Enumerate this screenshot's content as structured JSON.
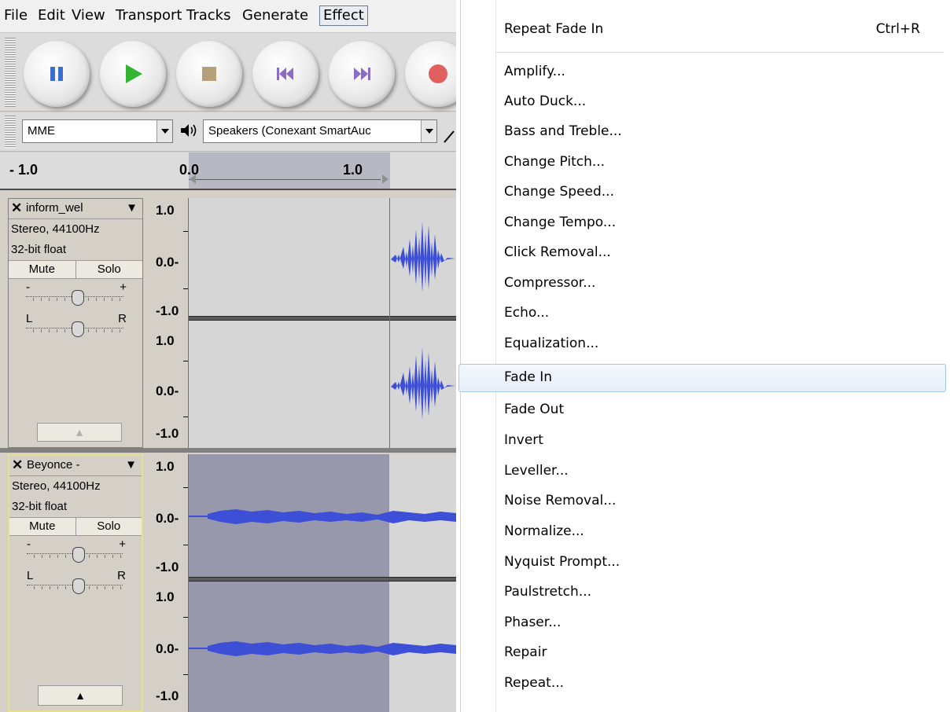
{
  "menubar": {
    "items": [
      "File",
      "Edit",
      "View",
      "Transport",
      "Tracks",
      "Generate",
      "Effect"
    ]
  },
  "devices": {
    "host": "MME",
    "output": "Speakers (Conexant SmartAuc"
  },
  "ruler": {
    "labels": [
      "- 1.0",
      "0.0",
      "1.0"
    ]
  },
  "tracks": [
    {
      "name": "inform_wel",
      "format": "Stereo, 44100Hz",
      "bits": "32-bit float",
      "mute": "Mute",
      "solo": "Solo",
      "gain_minus": "-",
      "gain_plus": "+",
      "pan_left": "L",
      "pan_right": "R",
      "scale": [
        "1.0",
        "0.0-",
        "-1.0",
        "1.0",
        "0.0-",
        "-1.0"
      ]
    },
    {
      "name": "Beyonce -",
      "format": "Stereo, 44100Hz",
      "bits": "32-bit float",
      "mute": "Mute",
      "solo": "Solo",
      "gain_minus": "-",
      "gain_plus": "+",
      "pan_left": "L",
      "pan_right": "R",
      "scale": [
        "1.0",
        "0.0-",
        "-1.0",
        "1.0",
        "0.0-",
        "-1.0"
      ]
    }
  ],
  "effect_menu": {
    "repeat": {
      "label": "Repeat Fade In",
      "shortcut": "Ctrl+R"
    },
    "items": [
      "Amplify...",
      "Auto Duck...",
      "Bass and Treble...",
      "Change Pitch...",
      "Change Speed...",
      "Change Tempo...",
      "Click Removal...",
      "Compressor...",
      "Echo...",
      "Equalization...",
      "Fade In",
      "Fade Out",
      "Invert",
      "Leveller...",
      "Noise Removal...",
      "Normalize...",
      "Nyquist Prompt...",
      "Paulstretch...",
      "Phaser...",
      "Repair",
      "Repeat..."
    ],
    "highlighted": "Fade In"
  },
  "colors": {
    "waveform": "#3c4fd6",
    "selection": "#9898ac",
    "unselected": "#d6d6d6",
    "record": "#e06060",
    "play": "#32b432"
  }
}
